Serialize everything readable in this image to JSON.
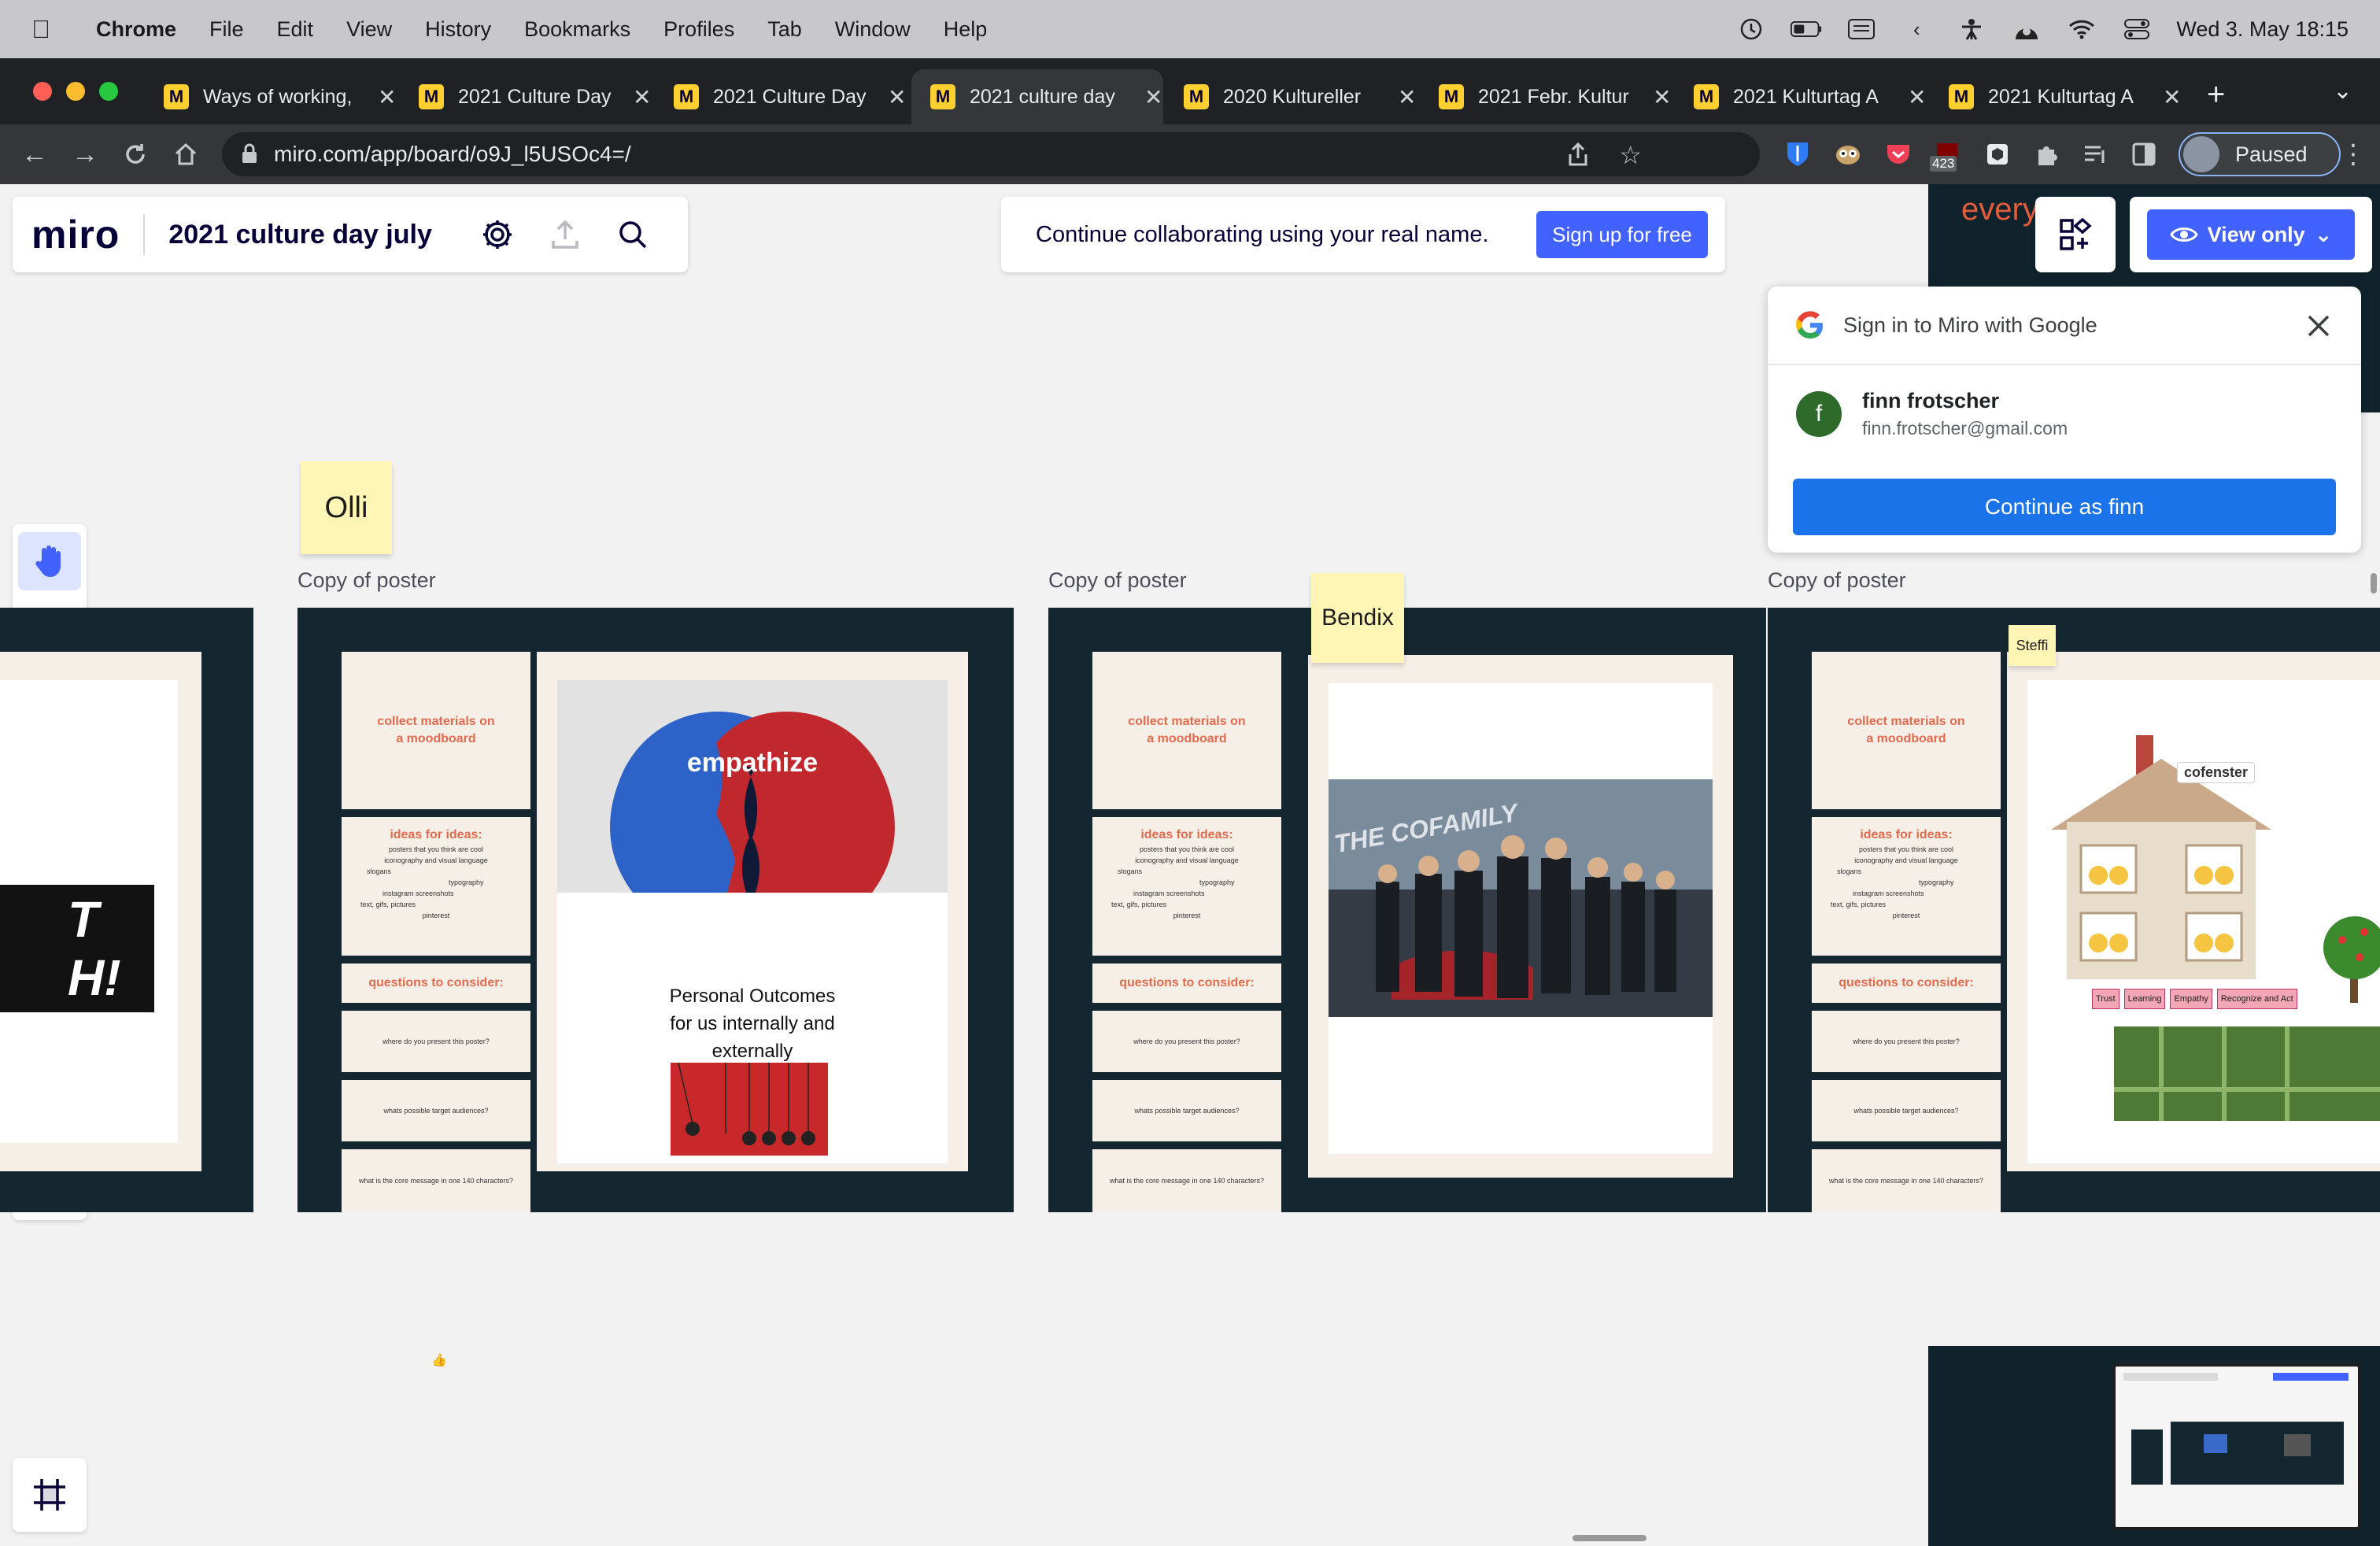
{
  "menubar": {
    "app": "Chrome",
    "items": [
      "File",
      "Edit",
      "View",
      "History",
      "Bookmarks",
      "Profiles",
      "Tab",
      "Window",
      "Help"
    ],
    "datetime": "Wed 3. May  18:15"
  },
  "tabs": [
    {
      "title": "Ways of working,",
      "active": false
    },
    {
      "title": "2021 Culture Day",
      "active": false
    },
    {
      "title": "2021 Culture Day",
      "active": false
    },
    {
      "title": "2021 culture day",
      "active": true
    },
    {
      "title": "2020 Kultureller",
      "active": false
    },
    {
      "title": "2021 Febr. Kultur",
      "active": false
    },
    {
      "title": "2021 Kulturtag A",
      "active": false
    },
    {
      "title": "2021 Kulturtag A",
      "active": false
    }
  ],
  "address": {
    "url": "miro.com/app/board/o9J_l5USOc4=/",
    "badge_count": "423",
    "profile_status": "Paused"
  },
  "board": {
    "logo": "miro",
    "name": "2021 culture day july"
  },
  "banner": {
    "text": "Continue collaborating using your real name.",
    "button": "Sign up for free"
  },
  "view_only": "View only",
  "dark_strip_text": "every",
  "google_signin": {
    "title": "Sign in to Miro with Google",
    "avatar_letter": "f",
    "name": "finn frotscher",
    "email": "finn.frotscher@gmail.com",
    "continue": "Continue as finn"
  },
  "left_tools": [
    "hand-icon",
    "comment-icon",
    "text-icon",
    "sticky-note-icon",
    "shapes-icon",
    "arrow-icon",
    "pen-icon",
    "template-icon",
    "frame-icon",
    "upload-icon"
  ],
  "stickies": {
    "olli": "Olli",
    "bendix": "Bendix",
    "steffi": "Steffi"
  },
  "frames": [
    {
      "label": "Copy of poster"
    },
    {
      "label": "Copy of poster"
    },
    {
      "label": "Copy of poster"
    }
  ],
  "poster": {
    "collect": "collect materials on a moodboard",
    "ideas_title": "ideas for ideas:",
    "ideas_items": [
      "posters that you think are cool",
      "iconography and visual language",
      "slogans",
      "typography",
      "instagram screenshots",
      "text, gifs, pictures",
      "emojis",
      "pinterest"
    ],
    "questions_title": "questions to consider:",
    "q1": "where do you present this poster?",
    "q2": "whats possible target audiences?",
    "q3": "what is the core message in one 140 characters?"
  },
  "poster1": {
    "image_word": "empathize",
    "outcome_text": "Personal Outcomes for us internally and externally"
  },
  "poster2": {
    "image_word": "THE COFAMILY"
  },
  "poster3": {
    "brand": "cofenster",
    "roof_labels": [
      "Trust",
      "Learning",
      "Empathy",
      "Recognize and Act"
    ]
  },
  "partial_poster_text": "T H!",
  "colors": {
    "accent": "#4262ff",
    "frame": "#142730",
    "panel": "#f6efe8",
    "heading": "#e36b4d",
    "sticky": "#fff6b5"
  }
}
